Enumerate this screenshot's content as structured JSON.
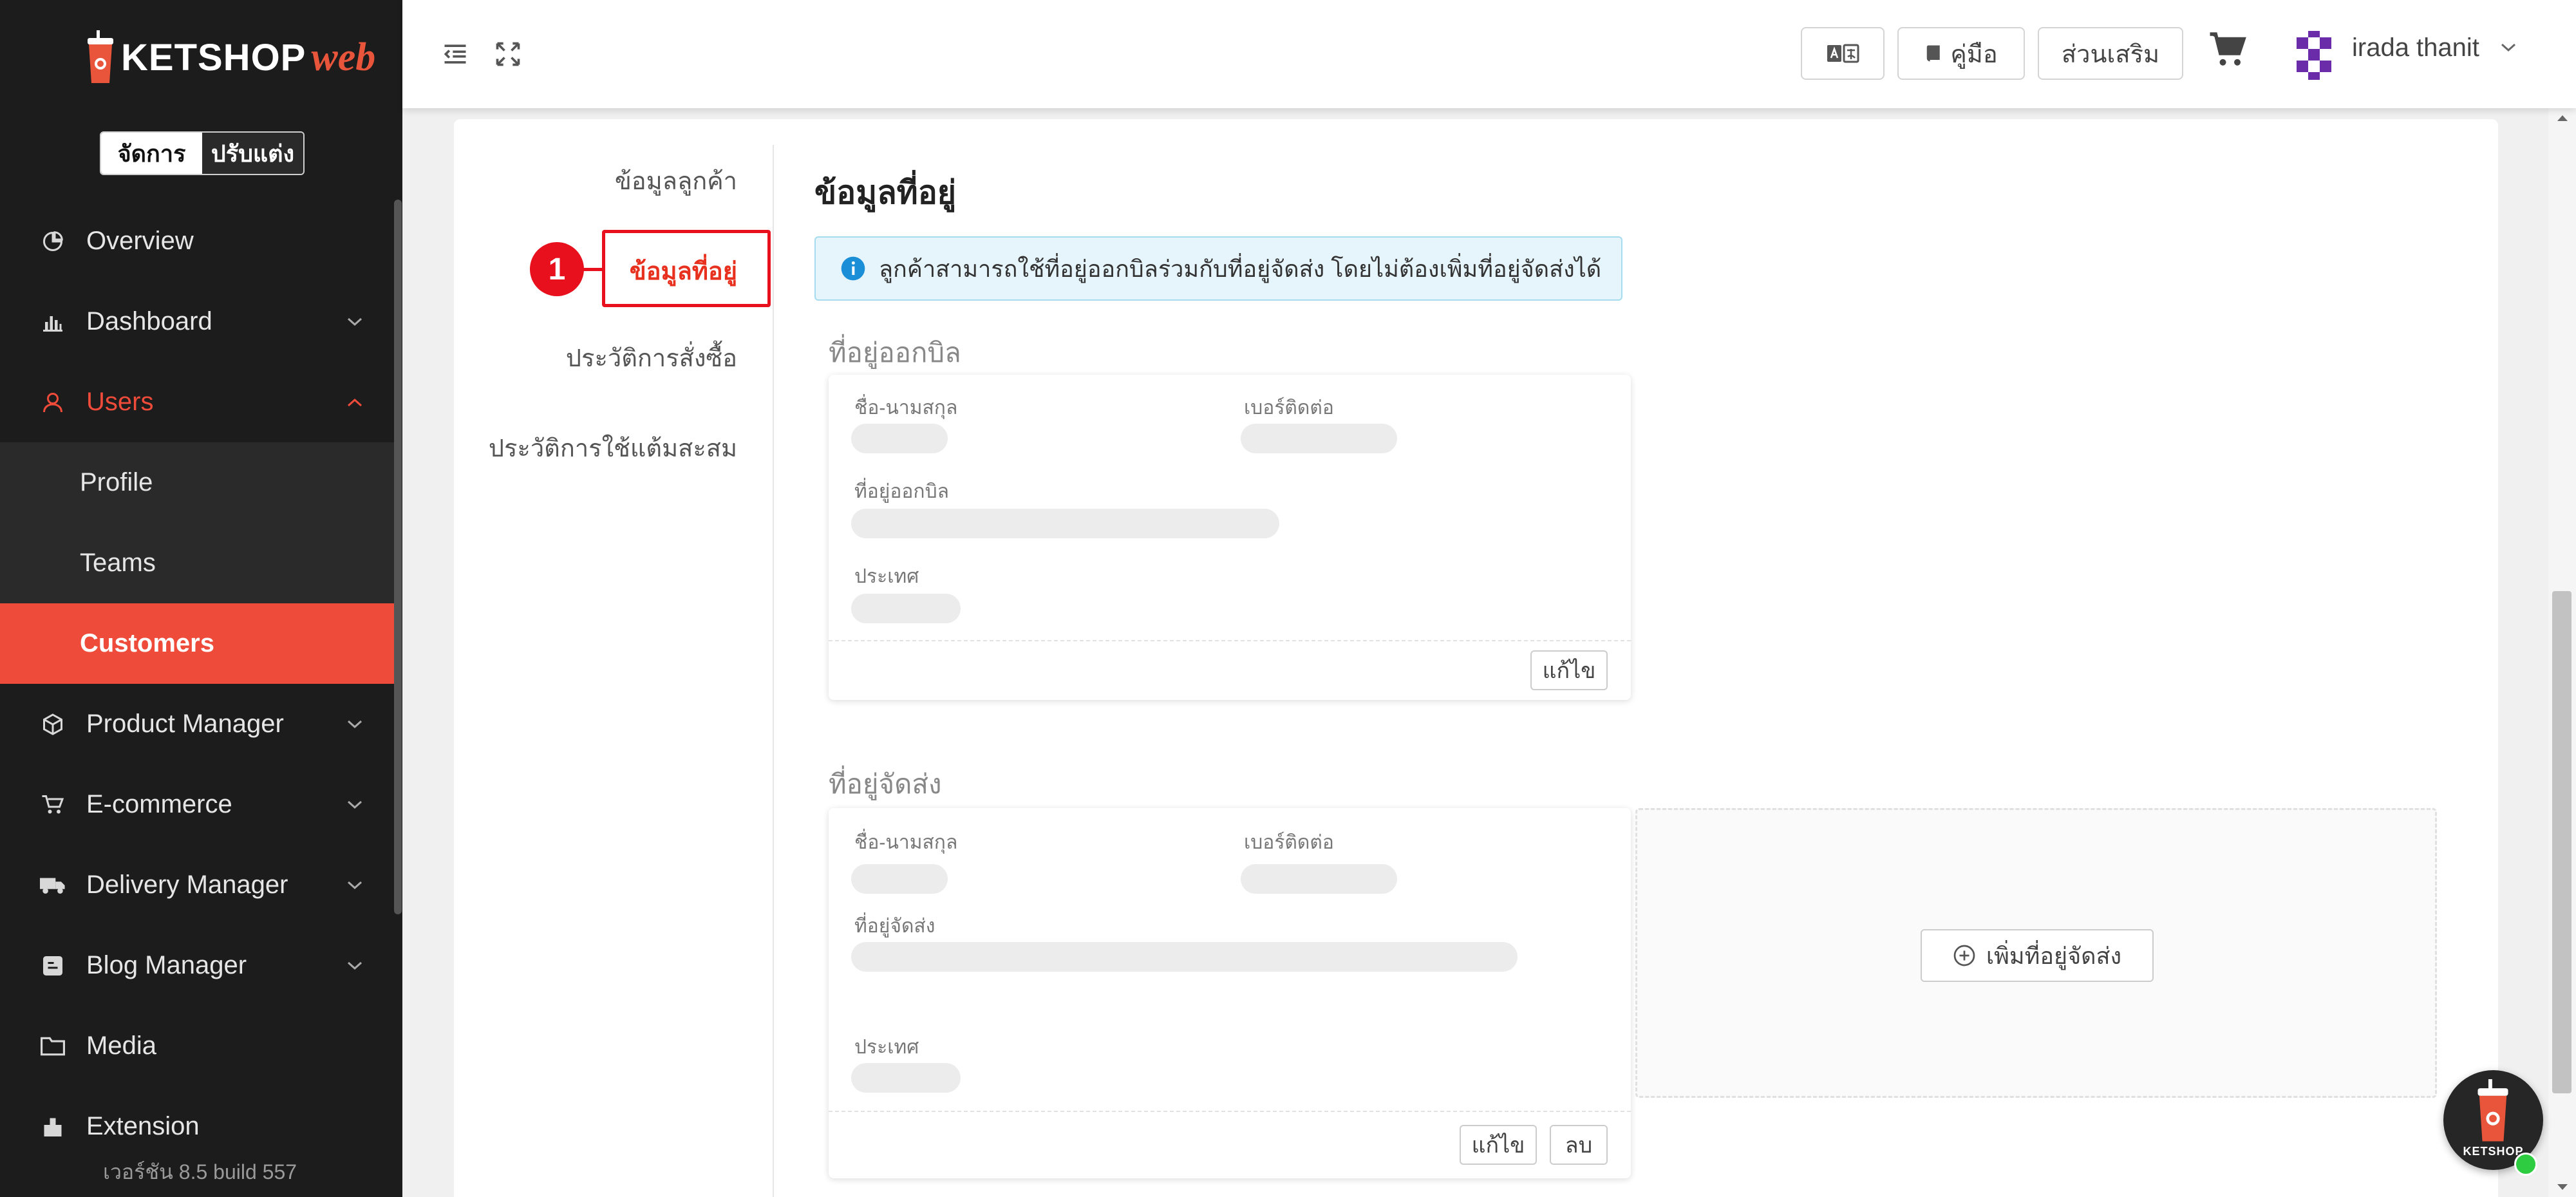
{
  "sidebar": {
    "logo": {
      "brand": "KETSHOP",
      "suffix": "web"
    },
    "mode_toggle": {
      "active": "จัดการ",
      "inactive": "ปรับแต่ง"
    },
    "nav": [
      {
        "label": "Overview",
        "icon": "pie-chart-icon"
      },
      {
        "label": "Dashboard",
        "icon": "bar-chart-icon"
      },
      {
        "label": "Users",
        "icon": "user-icon"
      },
      {
        "label": "Product Manager",
        "icon": "box-icon"
      },
      {
        "label": "E-commerce",
        "icon": "cart-icon"
      },
      {
        "label": "Delivery Manager",
        "icon": "truck-icon"
      },
      {
        "label": "Blog Manager",
        "icon": "blog-icon"
      },
      {
        "label": "Media",
        "icon": "folder-icon"
      },
      {
        "label": "Extension",
        "icon": "puzzle-icon"
      }
    ],
    "users_sub": [
      "Profile",
      "Teams",
      "Customers"
    ],
    "version": "เวอร์ชัน 8.5 build 557"
  },
  "topbar": {
    "manual_label": "คู่มือ",
    "extension_label": "ส่วนเสริม",
    "user_name": "irada thanit"
  },
  "tabs": {
    "items": [
      "ข้อมูลลูกค้า",
      "ข้อมูลที่อยู่",
      "ประวัติการสั่งซื้อ",
      "ประวัติการใช้แต้มสะสม"
    ],
    "step_number": "1"
  },
  "main": {
    "section_title": "ข้อมูลที่อยู่",
    "info_text": "ลูกค้าสามารถใช้ที่อยู่ออกบิลร่วมกับที่อยู่จัดส่ง โดยไม่ต้องเพิ่มที่อยู่จัดส่งได้",
    "billing": {
      "title": "ที่อยู่ออกบิล",
      "name_label": "ชื่อ-นามสกุล",
      "phone_label": "เบอร์ติดต่อ",
      "address_label": "ที่อยู่ออกบิล",
      "country_label": "ประเทศ",
      "edit_label": "แก้ไข"
    },
    "shipping": {
      "title": "ที่อยู่จัดส่ง",
      "name_label": "ชื่อ-นามสกุล",
      "phone_label": "เบอร์ติดต่อ",
      "address_label": "ที่อยู่จัดส่ง",
      "country_label": "ประเทศ",
      "edit_label": "แก้ไข",
      "delete_label": "ลบ"
    },
    "add_shipping_label": "เพิ่มที่อยู่จัดส่ง"
  },
  "chat": {
    "label": "KETSHOP"
  },
  "colors": {
    "accent": "#ef4b3a",
    "sidebar_bg": "#1c1c1c",
    "info_bg": "#e6f4fb",
    "highlight": "#e8101c"
  }
}
